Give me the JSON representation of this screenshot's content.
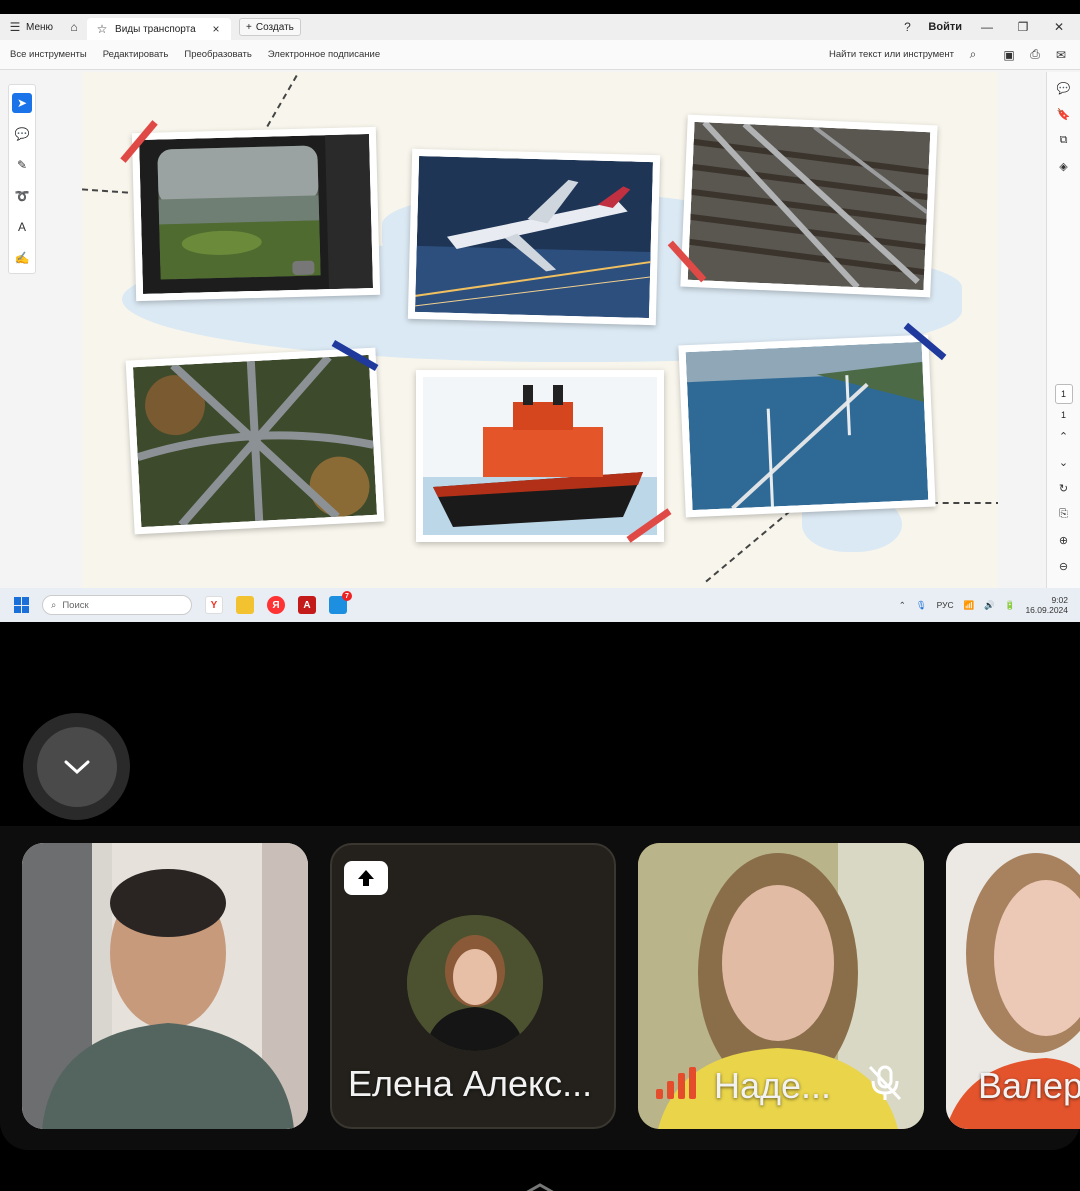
{
  "app": {
    "menu_label": "Меню",
    "tab_title": "Виды транспорта",
    "new_tab_label": "Создать",
    "login_label": "Войти"
  },
  "toolbar": {
    "items": [
      "Все инструменты",
      "Редактировать",
      "Преобразовать",
      "Электронное подписание"
    ],
    "search_label": "Найти текст или инструмент"
  },
  "pager": {
    "current_page": "1",
    "total_pages": "1"
  },
  "taskbar": {
    "search_placeholder": "Поиск",
    "yandex_label": "Я",
    "notification_count": "7",
    "language": "РУС",
    "time": "9:02",
    "date": "16.09.2024"
  },
  "participants": [
    {
      "name": ""
    },
    {
      "name": "Елена Алекс..."
    },
    {
      "name": "Наде..."
    },
    {
      "name": "Валер"
    }
  ],
  "colors": {
    "accent_blue": "#1a73e8",
    "tape_red": "#e04a46",
    "tape_blue": "#1f3a9c",
    "map_blue": "#dbe9f4",
    "signal_red": "#e44c2c"
  }
}
